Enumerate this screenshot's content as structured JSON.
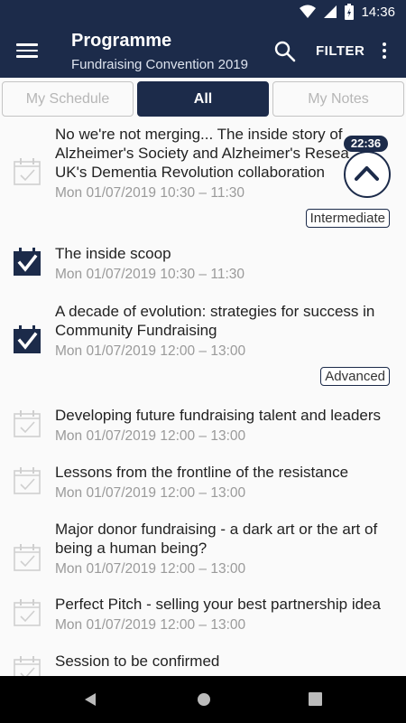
{
  "status": {
    "time": "14:36"
  },
  "appbar": {
    "title": "Programme",
    "subtitle": "Fundraising Convention 2019",
    "filter_label": "FILTER"
  },
  "tabs": [
    {
      "label": "My Schedule"
    },
    {
      "label": "All"
    },
    {
      "label": "My Notes"
    }
  ],
  "sessions": [
    {
      "title_lines": [
        "No we're not merging... The inside story of",
        "Alzheimer's Society and Alzheimer's Resea",
        "UK's Dementia Revolution collaboration"
      ],
      "time": "Mon 01/07/2019 10:30 – 11:30",
      "checked": false,
      "badge": "Intermediate"
    },
    {
      "title_lines": [
        "The inside scoop"
      ],
      "time": "Mon 01/07/2019 10:30 – 11:30",
      "checked": true,
      "badge": ""
    },
    {
      "title_lines": [
        "A decade of evolution: strategies for success in",
        "Community Fundraising"
      ],
      "time": "Mon 01/07/2019 12:00 – 13:00",
      "checked": true,
      "badge": "Advanced"
    },
    {
      "title_lines": [
        "Developing future fundraising talent and leaders"
      ],
      "time": "Mon 01/07/2019 12:00 – 13:00",
      "checked": false,
      "badge": ""
    },
    {
      "title_lines": [
        "Lessons from the frontline of the resistance"
      ],
      "time": "Mon 01/07/2019 12:00 – 13:00",
      "checked": false,
      "badge": ""
    },
    {
      "title_lines": [
        "Major donor fundraising - a dark art or the art of",
        "being a human being?"
      ],
      "time": "Mon 01/07/2019 12:00 – 13:00",
      "checked": false,
      "badge": ""
    },
    {
      "title_lines": [
        "Perfect Pitch - selling your best partnership idea"
      ],
      "time": "Mon 01/07/2019 12:00 – 13:00",
      "checked": false,
      "badge": ""
    },
    {
      "title_lines": [
        "Session to be confirmed"
      ],
      "time": "",
      "checked": false,
      "badge": ""
    }
  ],
  "scroll_top": {
    "time_label": "22:36"
  },
  "colors": {
    "primary": "#1c2b4a",
    "muted_text": "#9a9a9a",
    "unchecked_icon": "#cfcfcf"
  },
  "icons": {
    "menu": "menu-icon",
    "search": "search-icon",
    "more": "more-vert-icon",
    "checked": "calendar-check-icon",
    "unchecked": "calendar-outline-icon",
    "scroll_up": "chevron-up-icon"
  }
}
